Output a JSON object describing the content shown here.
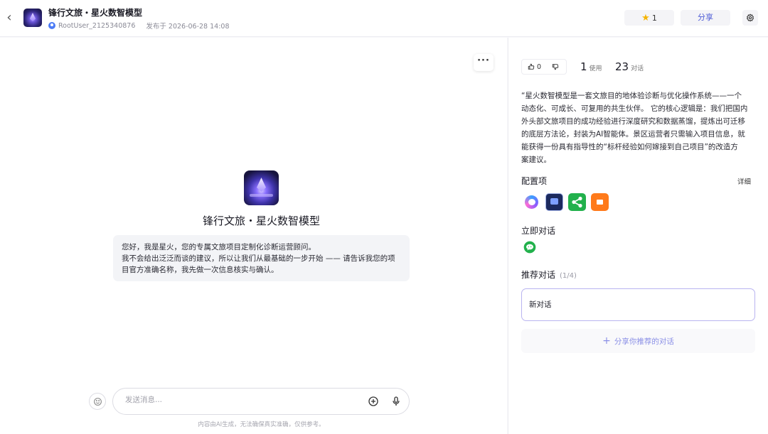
{
  "header": {
    "back_icon": "chevron-left-icon",
    "title": "锋行文旅・星火数智模型",
    "author": "RootUser_2125340876",
    "published": "发布于 2026-06-28 14:08",
    "star_count": "1",
    "share_label": "分享",
    "settings_icon": "gear-icon"
  },
  "chat": {
    "bot_name": "锋行文旅・星火数智模型",
    "greeting_lines": [
      "您好，我是星火，您的专属文旅项目定制化诊断运营顾问。",
      "我不会给出泛泛而谈的建议，所以让我们从最基础的一步开始 —— 请告诉我您的项",
      "目官方准确名称，我先做一次信息核实与确认。"
    ],
    "input_placeholder": "发送消息...",
    "disclaimer": "内容由AI生成，无法确保真实准确，仅供参考。"
  },
  "panel": {
    "likes": "0",
    "uses_num": "1",
    "uses_label": "使用",
    "chats_num": "23",
    "chats_label": "对话",
    "description_lines": [
      "“星火数智模型是一套文旅目的地体验诊断与优化操作系统——一个",
      "动态化、可成长、可复用的共生伙伴。 它的核心逻辑是：我们把国内",
      "外头部文旅项目的成功经验进行深度研究和数据蒸馏，提炼出可迁移",
      "的底层方法论，封装为AI智能体。景区运营者只需输入项目信息，就",
      "能获得一份具有指导性的“标杆经验如何嫁接到自己项目”的改造方",
      "案建议。"
    ],
    "config_title": "配置项",
    "config_detail": "详细",
    "instant_title": "立即对话",
    "recommend_title": "推荐对话",
    "recommend_count": "(1/4)",
    "new_chat_label": "新对话",
    "share_recommend_label": "分享你推荐的对话"
  },
  "colors": {
    "accent": "#4d5bd6",
    "star": "#f5b400",
    "wechat": "#22b14c"
  }
}
